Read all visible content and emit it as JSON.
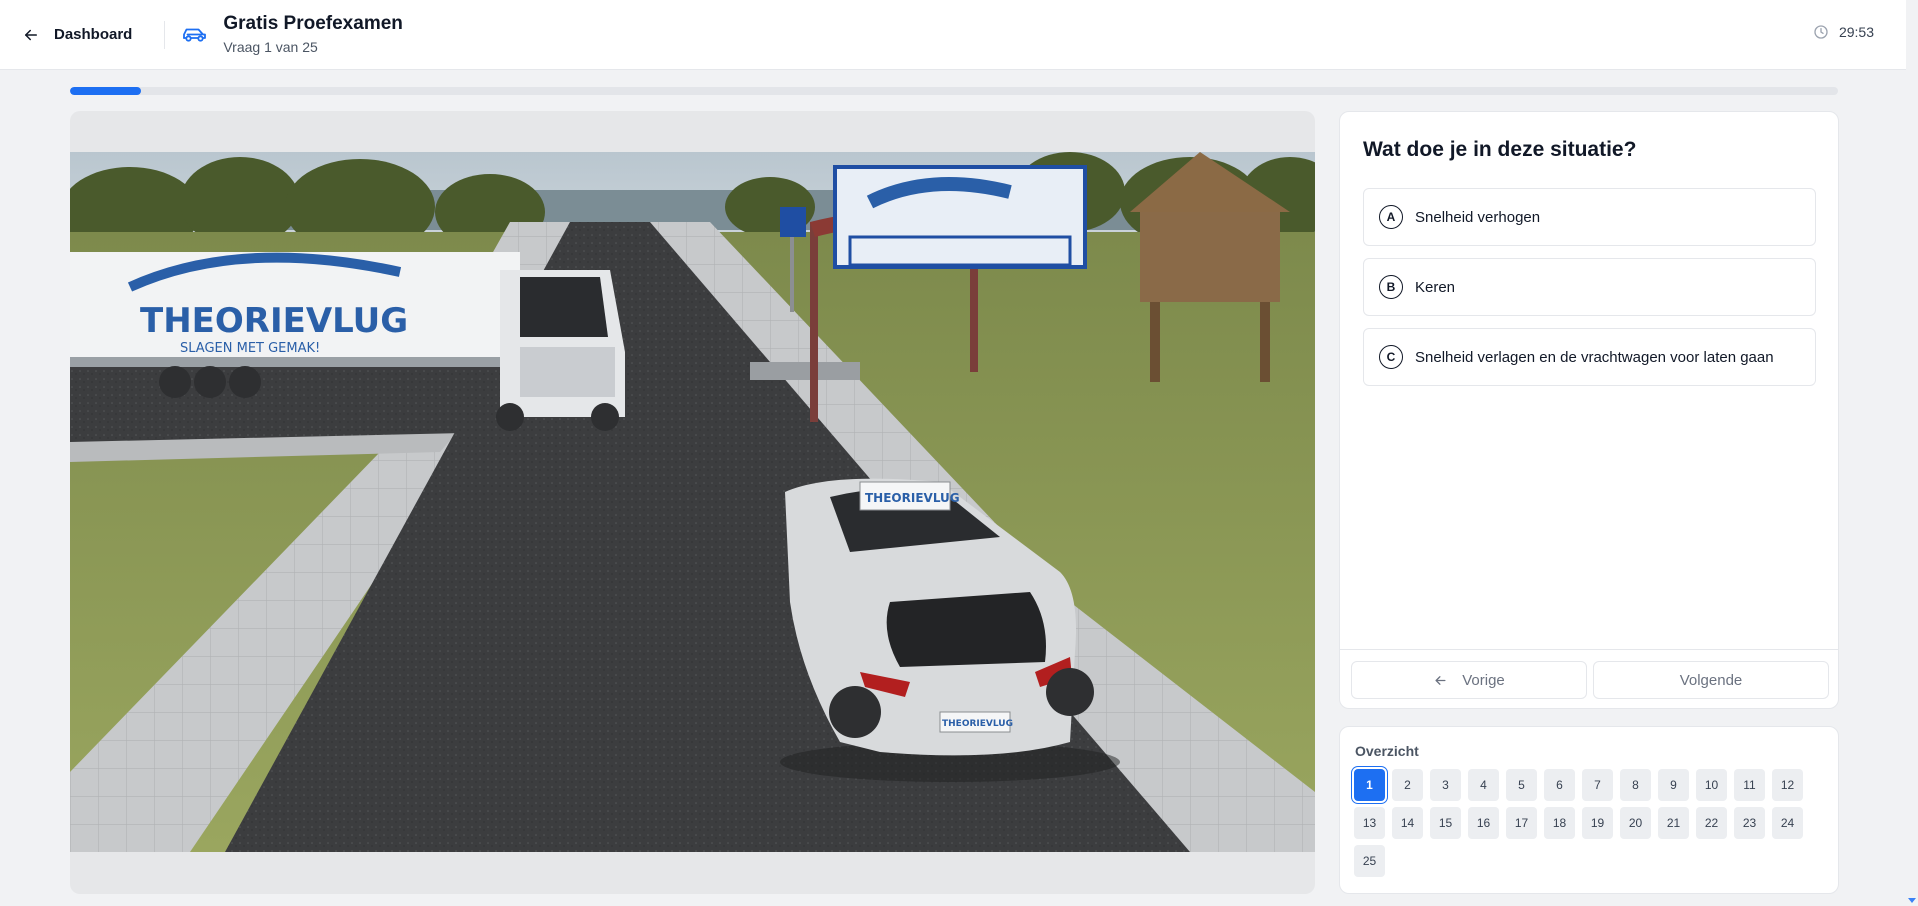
{
  "header": {
    "back_label": "Dashboard",
    "title": "Gratis Proefexamen",
    "subtitle": "Vraag 1 van 25",
    "timer": "29:53"
  },
  "progress": {
    "current": 1,
    "total": 25,
    "fraction": 0.04
  },
  "question": {
    "text": "Wat doe je in deze situatie?",
    "options": [
      {
        "letter": "A",
        "text": "Snelheid verhogen"
      },
      {
        "letter": "B",
        "text": "Keren"
      },
      {
        "letter": "C",
        "text": "Snelheid verlagen en de vrachtwagen voor laten gaan"
      }
    ]
  },
  "navigation": {
    "prev_label": "Vorige",
    "next_label": "Volgende"
  },
  "overview": {
    "label": "Overzicht",
    "active": 1,
    "numbers": [
      "1",
      "2",
      "3",
      "4",
      "5",
      "6",
      "7",
      "8",
      "9",
      "10",
      "11",
      "12",
      "13",
      "14",
      "15",
      "16",
      "17",
      "18",
      "19",
      "20",
      "21",
      "22",
      "23",
      "24",
      "25"
    ]
  },
  "scene": {
    "truck_brand": "THEORIEVLUG",
    "truck_slogan": "SLAGEN MET GEMAK!",
    "car_roof_sign": "THEORIEVLUG",
    "car_plate": "THEORIEVLUG"
  },
  "icons": {
    "back": "arrow-left-icon",
    "car": "car-icon",
    "timer": "clock-icon",
    "prev": "arrow-left-icon"
  },
  "colors": {
    "accent": "#1d6ff2",
    "truck_logo": "#2a5fa8"
  }
}
